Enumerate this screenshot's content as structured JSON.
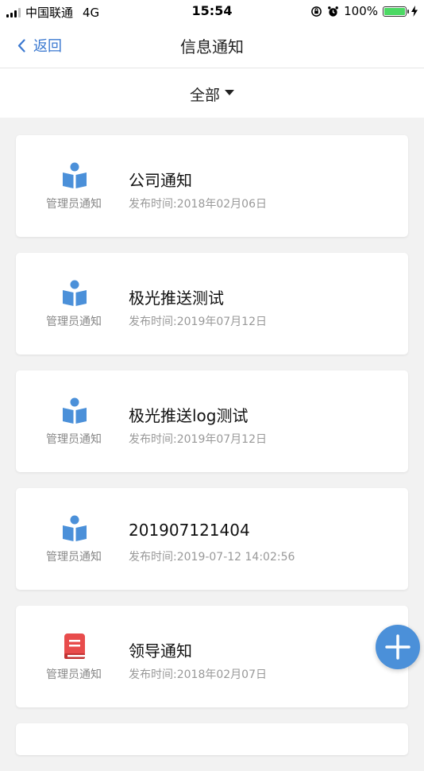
{
  "status_bar": {
    "carrier": "中国联通",
    "network": "4G",
    "time": "15:54",
    "battery": "100%",
    "battery_level": 1.0
  },
  "nav": {
    "back_label": "返回",
    "title": "信息通知"
  },
  "filter": {
    "label": "全部"
  },
  "notices": [
    {
      "icon": "reader-icon",
      "icon_color": "#4b90d9",
      "source": "管理员通知",
      "title": "公司通知",
      "date": "发布时间:2018年02月06日"
    },
    {
      "icon": "reader-icon",
      "icon_color": "#4b90d9",
      "source": "管理员通知",
      "title": "极光推送测试",
      "date": "发布时间:2019年07月12日"
    },
    {
      "icon": "reader-icon",
      "icon_color": "#4b90d9",
      "source": "管理员通知",
      "title": "极光推送log测试",
      "date": "发布时间:2019年07月12日"
    },
    {
      "icon": "reader-icon",
      "icon_color": "#4b90d9",
      "source": "管理员通知",
      "title": "201907121404",
      "date": "发布时间:2019-07-12 14:02:56"
    },
    {
      "icon": "book-icon",
      "icon_color": "#e84c4c",
      "source": "管理员通知",
      "title": "领导通知",
      "date": "发布时间:2018年02月07日"
    }
  ],
  "colors": {
    "accent": "#3a78d0",
    "fab": "#4b90d9"
  }
}
